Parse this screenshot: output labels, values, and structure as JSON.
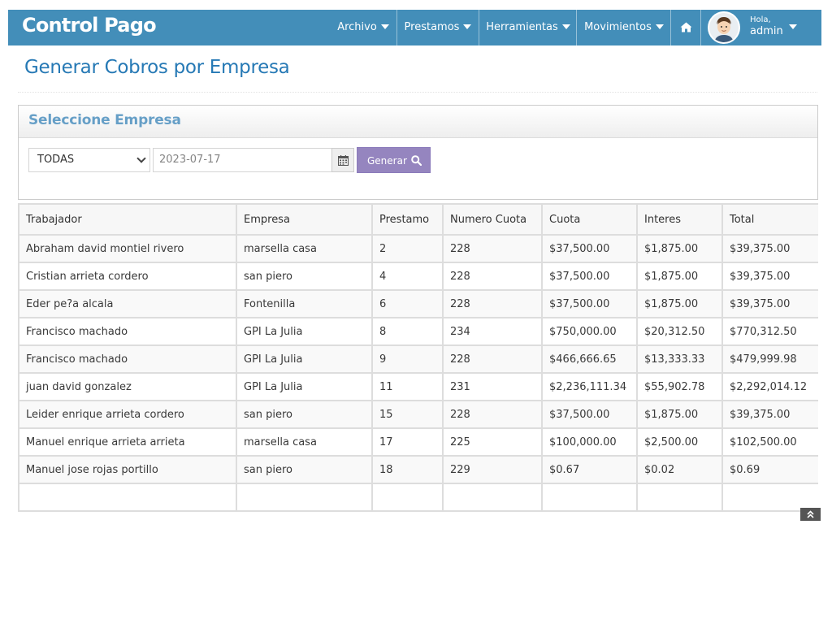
{
  "app": {
    "brand": "Control Pago"
  },
  "nav": {
    "items": [
      {
        "label": "Archivo"
      },
      {
        "label": "Prestamos"
      },
      {
        "label": "Herramientas"
      },
      {
        "label": "Movimientos"
      }
    ],
    "home_icon": "home-icon",
    "user": {
      "greeting": "Hola,",
      "name": "admin"
    }
  },
  "page": {
    "title": "Generar Cobros por Empresa"
  },
  "form": {
    "section_title": "Seleccione Empresa",
    "empresa_selected": "TODAS",
    "date_value": "2023-07-17",
    "date_icon": "calendar-icon",
    "generate_label": "Generar",
    "generate_icon": "search-icon"
  },
  "table": {
    "headers": [
      "Trabajador",
      "Empresa",
      "Prestamo",
      "Numero Cuota",
      "Cuota",
      "Interes",
      "Total"
    ],
    "rows": [
      [
        "Abraham david montiel rivero",
        "marsella casa",
        "2",
        "228",
        "$37,500.00",
        "$1,875.00",
        "$39,375.00"
      ],
      [
        "Cristian arrieta cordero",
        "san piero",
        "4",
        "228",
        "$37,500.00",
        "$1,875.00",
        "$39,375.00"
      ],
      [
        "Eder pe?a alcala",
        "Fontenilla",
        "6",
        "228",
        "$37,500.00",
        "$1,875.00",
        "$39,375.00"
      ],
      [
        "Francisco machado",
        "GPI La Julia",
        "8",
        "234",
        "$750,000.00",
        "$20,312.50",
        "$770,312.50"
      ],
      [
        "Francisco machado",
        "GPI La Julia",
        "9",
        "228",
        "$466,666.65",
        "$13,333.33",
        "$479,999.98"
      ],
      [
        "juan david gonzalez",
        "GPI La Julia",
        "11",
        "231",
        "$2,236,111.34",
        "$55,902.78",
        "$2,292,014.12"
      ],
      [
        "Leider enrique arrieta cordero",
        "san piero",
        "15",
        "228",
        "$37,500.00",
        "$1,875.00",
        "$39,375.00"
      ],
      [
        "Manuel enrique arrieta arrieta",
        "marsella casa",
        "17",
        "225",
        "$100,000.00",
        "$2,500.00",
        "$102,500.00"
      ],
      [
        "Manuel jose rojas portillo",
        "san piero",
        "18",
        "229",
        "$0.67",
        "$0.02",
        "$0.69"
      ],
      [
        "",
        "",
        "",
        "",
        "",
        "",
        ""
      ]
    ]
  },
  "colors": {
    "navbar": "#438eb9",
    "title": "#2679b5",
    "section_title": "#669fc7",
    "button": "#9585bf"
  }
}
